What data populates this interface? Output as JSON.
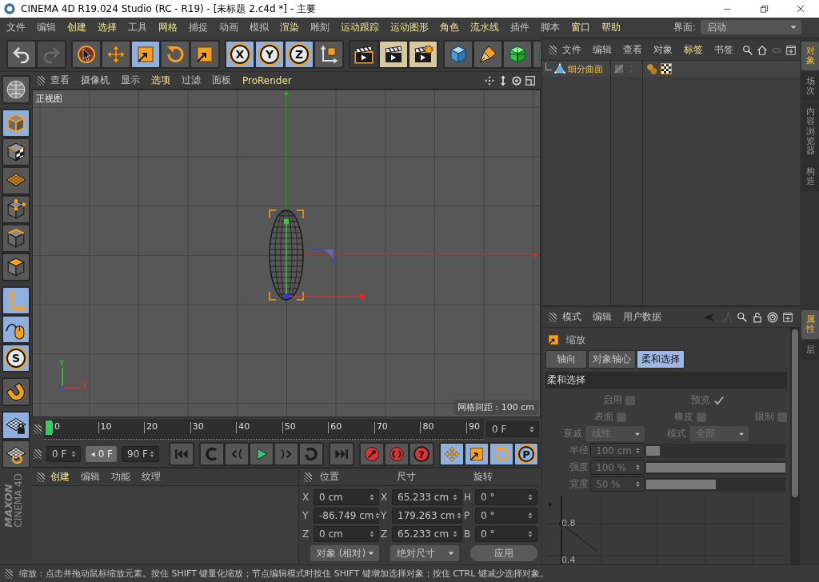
{
  "window": {
    "title": "CINEMA 4D R19.024 Studio (RC - R19) - [未标题 2.c4d *] - 主要"
  },
  "menu": [
    {
      "label": "文件",
      "highlighted": false
    },
    {
      "label": "编辑",
      "highlighted": false
    },
    {
      "label": "创建",
      "highlighted": true
    },
    {
      "label": "选择",
      "highlighted": true
    },
    {
      "label": "工具",
      "highlighted": false
    },
    {
      "label": "网格",
      "highlighted": true
    },
    {
      "label": "捕捉",
      "highlighted": false
    },
    {
      "label": "动画",
      "highlighted": false
    },
    {
      "label": "模拟",
      "highlighted": false
    },
    {
      "label": "渲染",
      "highlighted": true
    },
    {
      "label": "雕刻",
      "highlighted": false
    },
    {
      "label": "运动跟踪",
      "highlighted": true
    },
    {
      "label": "运动图形",
      "highlighted": true
    },
    {
      "label": "角色",
      "highlighted": true
    },
    {
      "label": "流水线",
      "highlighted": true
    },
    {
      "label": "插件",
      "highlighted": false
    },
    {
      "label": "脚本",
      "highlighted": false
    },
    {
      "label": "窗口",
      "highlighted": true
    },
    {
      "label": "帮助",
      "highlighted": true
    }
  ],
  "layout": {
    "label": "界面:",
    "value": "启动"
  },
  "toolbar": [
    {
      "buttons": [
        {
          "kind": "undo",
          "selected": false,
          "disabled": false
        },
        {
          "kind": "redo",
          "selected": false,
          "disabled": true
        }
      ]
    },
    {
      "buttons": [
        {
          "kind": "select",
          "selected": false,
          "disabled": false
        },
        {
          "kind": "move",
          "selected": false,
          "disabled": false
        },
        {
          "kind": "scale",
          "selected": true,
          "disabled": false
        },
        {
          "kind": "rotate",
          "selected": false,
          "disabled": false
        },
        {
          "kind": "scale",
          "selected": false,
          "disabled": false
        }
      ]
    },
    {
      "buttons": [
        {
          "kind": "axis",
          "label": "X",
          "selected": true,
          "disabled": false
        },
        {
          "kind": "axis",
          "label": "Y",
          "selected": true,
          "disabled": false
        },
        {
          "kind": "axis",
          "label": "Z",
          "selected": true,
          "disabled": false
        },
        {
          "kind": "coordinates",
          "selected": false,
          "disabled": false
        }
      ]
    },
    {
      "buttons": [
        {
          "kind": "render-view",
          "selected": false,
          "disabled": false
        },
        {
          "kind": "render",
          "selected": false,
          "disabled": false
        },
        {
          "kind": "render-settings",
          "selected": false,
          "disabled": false
        }
      ]
    },
    {
      "buttons": [
        {
          "kind": "cube",
          "selected": false,
          "disabled": false
        },
        {
          "kind": "pen",
          "selected": false,
          "disabled": false
        },
        {
          "kind": "subdivision",
          "selected": false,
          "disabled": false
        },
        {
          "kind": "generator",
          "selected": false,
          "disabled": false
        }
      ]
    }
  ],
  "left_toolbar": [
    {
      "buttons": [
        {
          "kind": "view",
          "selected": false
        }
      ]
    },
    {
      "buttons": [
        {
          "kind": "model",
          "selected": true
        },
        {
          "kind": "texture",
          "selected": false
        },
        {
          "kind": "workplane",
          "selected": false
        },
        {
          "kind": "points",
          "selected": false
        },
        {
          "kind": "edges",
          "selected": false
        },
        {
          "kind": "polygons",
          "selected": false
        }
      ]
    },
    {
      "buttons": [
        {
          "kind": "axis-mode",
          "selected": true
        },
        {
          "kind": "tweak",
          "selected": true
        },
        {
          "kind": "snap",
          "label": "S",
          "selected": true
        }
      ]
    },
    {
      "buttons": [
        {
          "kind": "magnet",
          "selected": false
        }
      ]
    },
    {
      "buttons": [
        {
          "kind": "grid-lock",
          "selected": true
        },
        {
          "kind": "grid-refresh",
          "selected": false
        }
      ]
    }
  ],
  "logo": {
    "brand": "MAXON",
    "product": "CINEMA 4D"
  },
  "viewport": {
    "menu": [
      {
        "label": "查看",
        "highlighted": false
      },
      {
        "label": "摄像机",
        "highlighted": false
      },
      {
        "label": "显示",
        "highlighted": false
      },
      {
        "label": "选项",
        "highlighted": true
      },
      {
        "label": "过滤",
        "highlighted": false
      },
      {
        "label": "面板",
        "highlighted": false
      },
      {
        "label": "ProRender",
        "highlighted": true
      }
    ],
    "view_name": "正视图",
    "grid_spacing": "网格间距 : 100 cm",
    "gizmo": {
      "y": "Y",
      "x": "X"
    }
  },
  "timeline": {
    "ticks": [
      "0",
      "10",
      "20",
      "30",
      "40",
      "50",
      "60",
      "70",
      "80",
      "90"
    ],
    "playhead": {
      "level": 0
    },
    "frame": "0 F"
  },
  "transport": {
    "start": "0 F",
    "preview": "0 F",
    "end": "90 F",
    "groups": [
      {
        "buttons": [
          {
            "kind": "go-start",
            "selected": false
          }
        ]
      },
      {
        "buttons": [
          {
            "kind": "loop-back",
            "selected": false
          },
          {
            "kind": "step-back",
            "selected": false
          },
          {
            "kind": "play",
            "selected": false
          },
          {
            "kind": "step-forward",
            "selected": false
          },
          {
            "kind": "loop-forward",
            "selected": false
          }
        ]
      },
      {
        "buttons": [
          {
            "kind": "go-end",
            "selected": false
          }
        ]
      },
      {
        "buttons": [
          {
            "kind": "record",
            "selected": false
          },
          {
            "kind": "auto-key",
            "selected": false
          },
          {
            "kind": "help",
            "label": "?",
            "selected": false
          }
        ]
      },
      {
        "buttons": [
          {
            "kind": "move",
            "selected": true
          },
          {
            "kind": "scale",
            "selected": true
          },
          {
            "kind": "rotate",
            "selected": true
          },
          {
            "kind": "param",
            "label": "P",
            "selected": true
          }
        ]
      }
    ]
  },
  "materials": {
    "menu": [
      {
        "label": "创建",
        "highlighted": true
      },
      {
        "label": "编辑",
        "highlighted": false
      },
      {
        "label": "功能",
        "highlighted": false
      },
      {
        "label": "纹理",
        "highlighted": false
      }
    ]
  },
  "coordinates": {
    "headers": [
      "位置",
      "尺寸",
      "旋转"
    ],
    "rows": [
      {
        "position_axis": "X",
        "position": "0 cm",
        "size_axis": "X",
        "size": "65.233 cm",
        "rotation_axis": "H",
        "rotation": "0 °"
      },
      {
        "position_axis": "Y",
        "position": "-86.749 cm",
        "size_axis": "Y",
        "size": "179.263 cm",
        "rotation_axis": "P",
        "rotation": "0 °"
      },
      {
        "position_axis": "Z",
        "position": "0 cm",
        "size_axis": "Z",
        "size": "65.233 cm",
        "rotation_axis": "B",
        "rotation": "0 °"
      }
    ],
    "position_mode": "对象 (相对)",
    "size_mode": "绝对尺寸",
    "apply": "应用"
  },
  "objects": {
    "menu": [
      {
        "label": "文件",
        "highlighted": false
      },
      {
        "label": "编辑",
        "highlighted": false
      },
      {
        "label": "查看",
        "highlighted": false
      },
      {
        "label": "对象",
        "highlighted": false
      },
      {
        "label": "标签",
        "highlighted": true
      },
      {
        "label": "书签",
        "highlighted": false
      }
    ],
    "items": [
      {
        "name": "细分曲面",
        "selected": true
      }
    ]
  },
  "object_tabs": [
    {
      "label": "对象",
      "selected": true
    },
    {
      "label": "场次",
      "selected": false
    },
    {
      "label": "内容浏览器",
      "selected": false
    },
    {
      "label": "构造",
      "selected": false
    }
  ],
  "attributes": {
    "menu": [
      "模式",
      "编辑",
      "用户数据"
    ],
    "tool": "缩放",
    "tabs": [
      {
        "label": "轴向",
        "selected": false
      },
      {
        "label": "对象轴心",
        "selected": false
      },
      {
        "label": "柔和选择",
        "selected": true
      }
    ],
    "section": "柔和选择",
    "disabled": true,
    "rows": [
      [
        {
          "kind": "checkbox",
          "label": "启用",
          "checked": false
        },
        {
          "kind": "checkbox",
          "label": "预览",
          "checked": true
        }
      ],
      [
        {
          "kind": "checkbox",
          "label": "表面",
          "checked": false
        },
        {
          "kind": "checkbox",
          "label": "橡皮",
          "checked": false
        },
        {
          "kind": "checkbox",
          "label": "限制",
          "checked": false
        }
      ],
      [
        {
          "kind": "dropdown",
          "label": "衰减",
          "value": "线性"
        },
        {
          "kind": "dropdown",
          "label": "模式",
          "value": "全部"
        }
      ],
      [
        {
          "kind": "slider",
          "label": "半径",
          "value": "100 cm",
          "level": 0.1
        }
      ],
      [
        {
          "kind": "slider",
          "label": "强度",
          "value": "100 %",
          "level": 1
        }
      ],
      [
        {
          "kind": "slider",
          "label": "宽度",
          "value": "50 %",
          "level": 0.5
        }
      ]
    ],
    "graph": {
      "labels": [
        "0.8",
        "0.4"
      ]
    }
  },
  "attribute_tabs": [
    {
      "label": "属性",
      "selected": true
    },
    {
      "label": "层",
      "selected": false
    }
  ],
  "status_bar": {
    "text": "缩放：点击并拖动鼠标缩放元素。按住 SHIFT 键量化缩放；节点编辑模式时按住 SHIFT 键增加选择对象；按住 CTRL 键减少选择对象。"
  }
}
